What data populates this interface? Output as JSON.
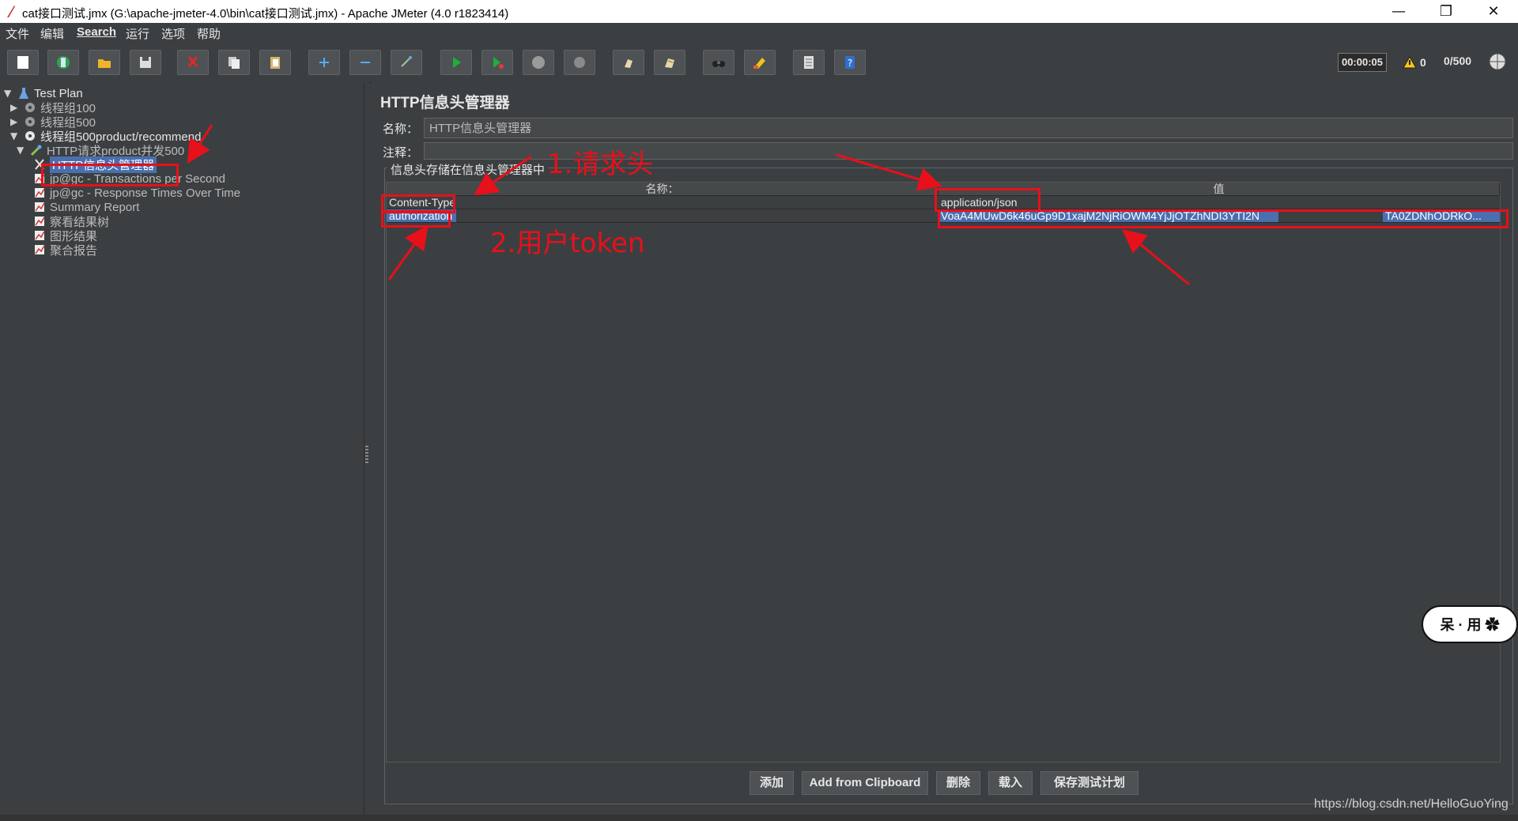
{
  "window": {
    "title": "cat接口测试.jmx (G:\\apache-jmeter-4.0\\bin\\cat接口测试.jmx) - Apache JMeter (4.0 r1823414)",
    "min_glyph": "—",
    "max_glyph": "❐",
    "close_glyph": "✕"
  },
  "menu": [
    "文件",
    "编辑",
    "Search",
    "运行",
    "选项",
    "帮助"
  ],
  "toolbar": {
    "timer": "00:00:05",
    "warnings": "0",
    "threads": "0/500"
  },
  "tree": {
    "items": [
      {
        "label": "Test Plan"
      },
      {
        "label": "线程组100"
      },
      {
        "label": "线程组500"
      },
      {
        "label": "线程组500product/recommend"
      },
      {
        "label": "HTTP请求product并发500"
      },
      {
        "label": "HTTP信息头管理器"
      },
      {
        "label": "jp@gc - Transactions per Second"
      },
      {
        "label": "jp@gc - Response Times Over Time"
      },
      {
        "label": "Summary Report"
      },
      {
        "label": "察看结果树"
      },
      {
        "label": "图形结果"
      },
      {
        "label": "聚合报告"
      }
    ]
  },
  "panel": {
    "title": "HTTP信息头管理器",
    "name_label": "名称：",
    "name_value": "HTTP信息头管理器",
    "comment_label": "注释：",
    "comment_value": "",
    "group_title": "信息头存储在信息头管理器中",
    "columns": [
      "名称：",
      "值"
    ],
    "rows": [
      {
        "name": "Content-Type",
        "value": "application/json"
      },
      {
        "name": "authorization",
        "value": "VoaA4MUwD6k46uGp9D1xajM2NjRiOWM4YjJjOTZhNDI3YTI2N",
        "value_tail": "TA0ZDNhODRkO..."
      }
    ],
    "buttons": [
      "添加",
      "Add from Clipboard",
      "删除",
      "载入",
      "保存测试计划"
    ]
  },
  "annotations": {
    "label1": "1.请求头",
    "label2": "2.用户token"
  },
  "badge_text": "呆 · 用 ✿",
  "watermark": "https://blog.csdn.net/HelloGuoYing",
  "colors": {
    "background": "#3c3f41",
    "selection": "#4b6eaf",
    "annotation": "#e8101a"
  }
}
